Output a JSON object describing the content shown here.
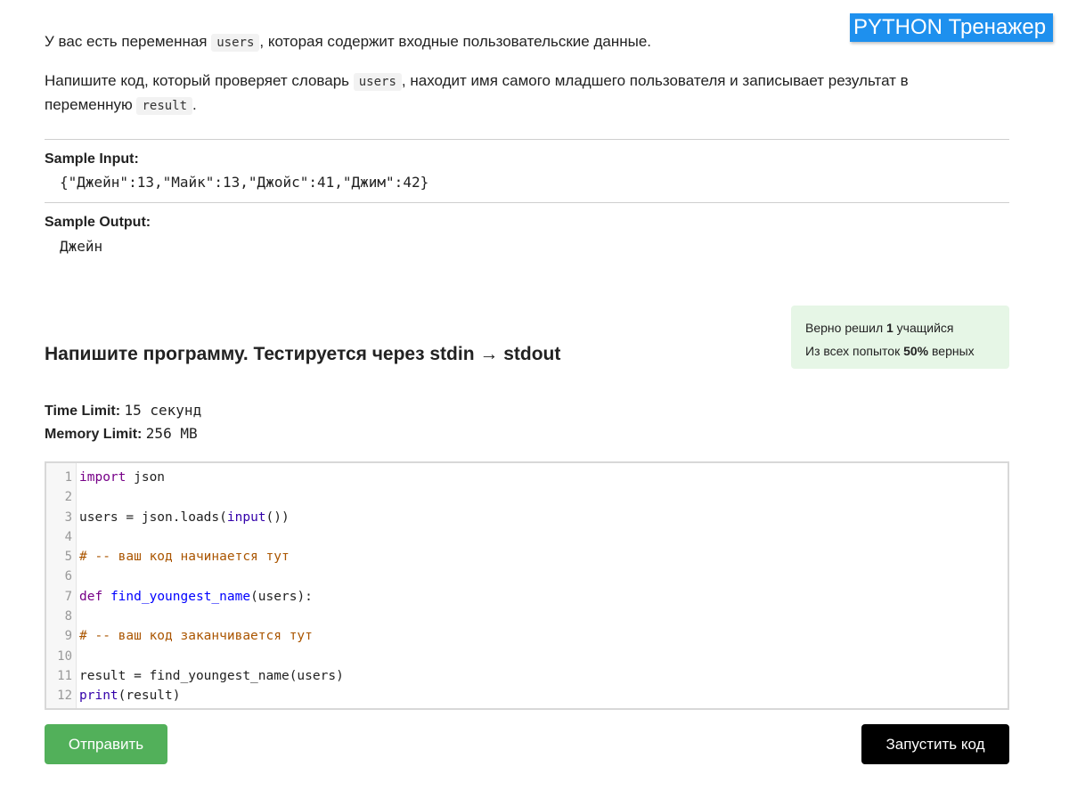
{
  "brand": {
    "label": "PYTHON Тренажер"
  },
  "task": {
    "p1_before": "У вас есть переменная ",
    "p1_code": "users",
    "p1_after": ", которая содержит входные пользовательские данные.",
    "p2_before": "Напишите код, который проверяет словарь ",
    "p2_code": "users",
    "p2_mid": ", находит имя самого младшего пользователя и записывает результат в переменную ",
    "p2_code2": "result",
    "p2_after": "."
  },
  "sample": {
    "input_label": "Sample Input:",
    "input_value": "{\"Джейн\":13,\"Майк\":13,\"Джойс\":41,\"Джим\":42}",
    "output_label": "Sample Output:",
    "output_value": "Джейн"
  },
  "stats": {
    "solved_prefix": "Верно решил ",
    "solved_count": "1",
    "solved_suffix": " учащийся",
    "attempts_prefix": "Из всех попыток ",
    "attempts_percent": "50%",
    "attempts_suffix": " верных"
  },
  "program_title": "Напишите программу. Тестируется через stdin → stdout",
  "limits": {
    "time_label": "Time Limit:",
    "time_value": "15 секунд",
    "memory_label": "Memory Limit:",
    "memory_value": "256 MB"
  },
  "editor": {
    "line_numbers": [
      "1",
      "2",
      "3",
      "4",
      "5",
      "6",
      "7",
      "8",
      "9",
      "10",
      "11",
      "12"
    ],
    "l1_kw": "import",
    "l1_rest": " json",
    "l3_a": "users = json.loads(",
    "l3_builtin": "input",
    "l3_b": "())",
    "l5_comment": "# -- ваш код начинается тут",
    "l7_kw": "def",
    "l7_sp": " ",
    "l7_def": "find_youngest_name",
    "l7_rest": "(users):",
    "l9_comment": "# -- ваш код заканчивается тут",
    "l11": "result = find_youngest_name(users)",
    "l12_builtin": "print",
    "l12_rest": "(result)"
  },
  "buttons": {
    "submit": "Отправить",
    "run": "Запустить код"
  },
  "colors": {
    "brand_bg": "#1e90ee",
    "submit_bg": "#52b05a",
    "run_bg": "#000000",
    "stats_bg": "#e6f6e6"
  }
}
